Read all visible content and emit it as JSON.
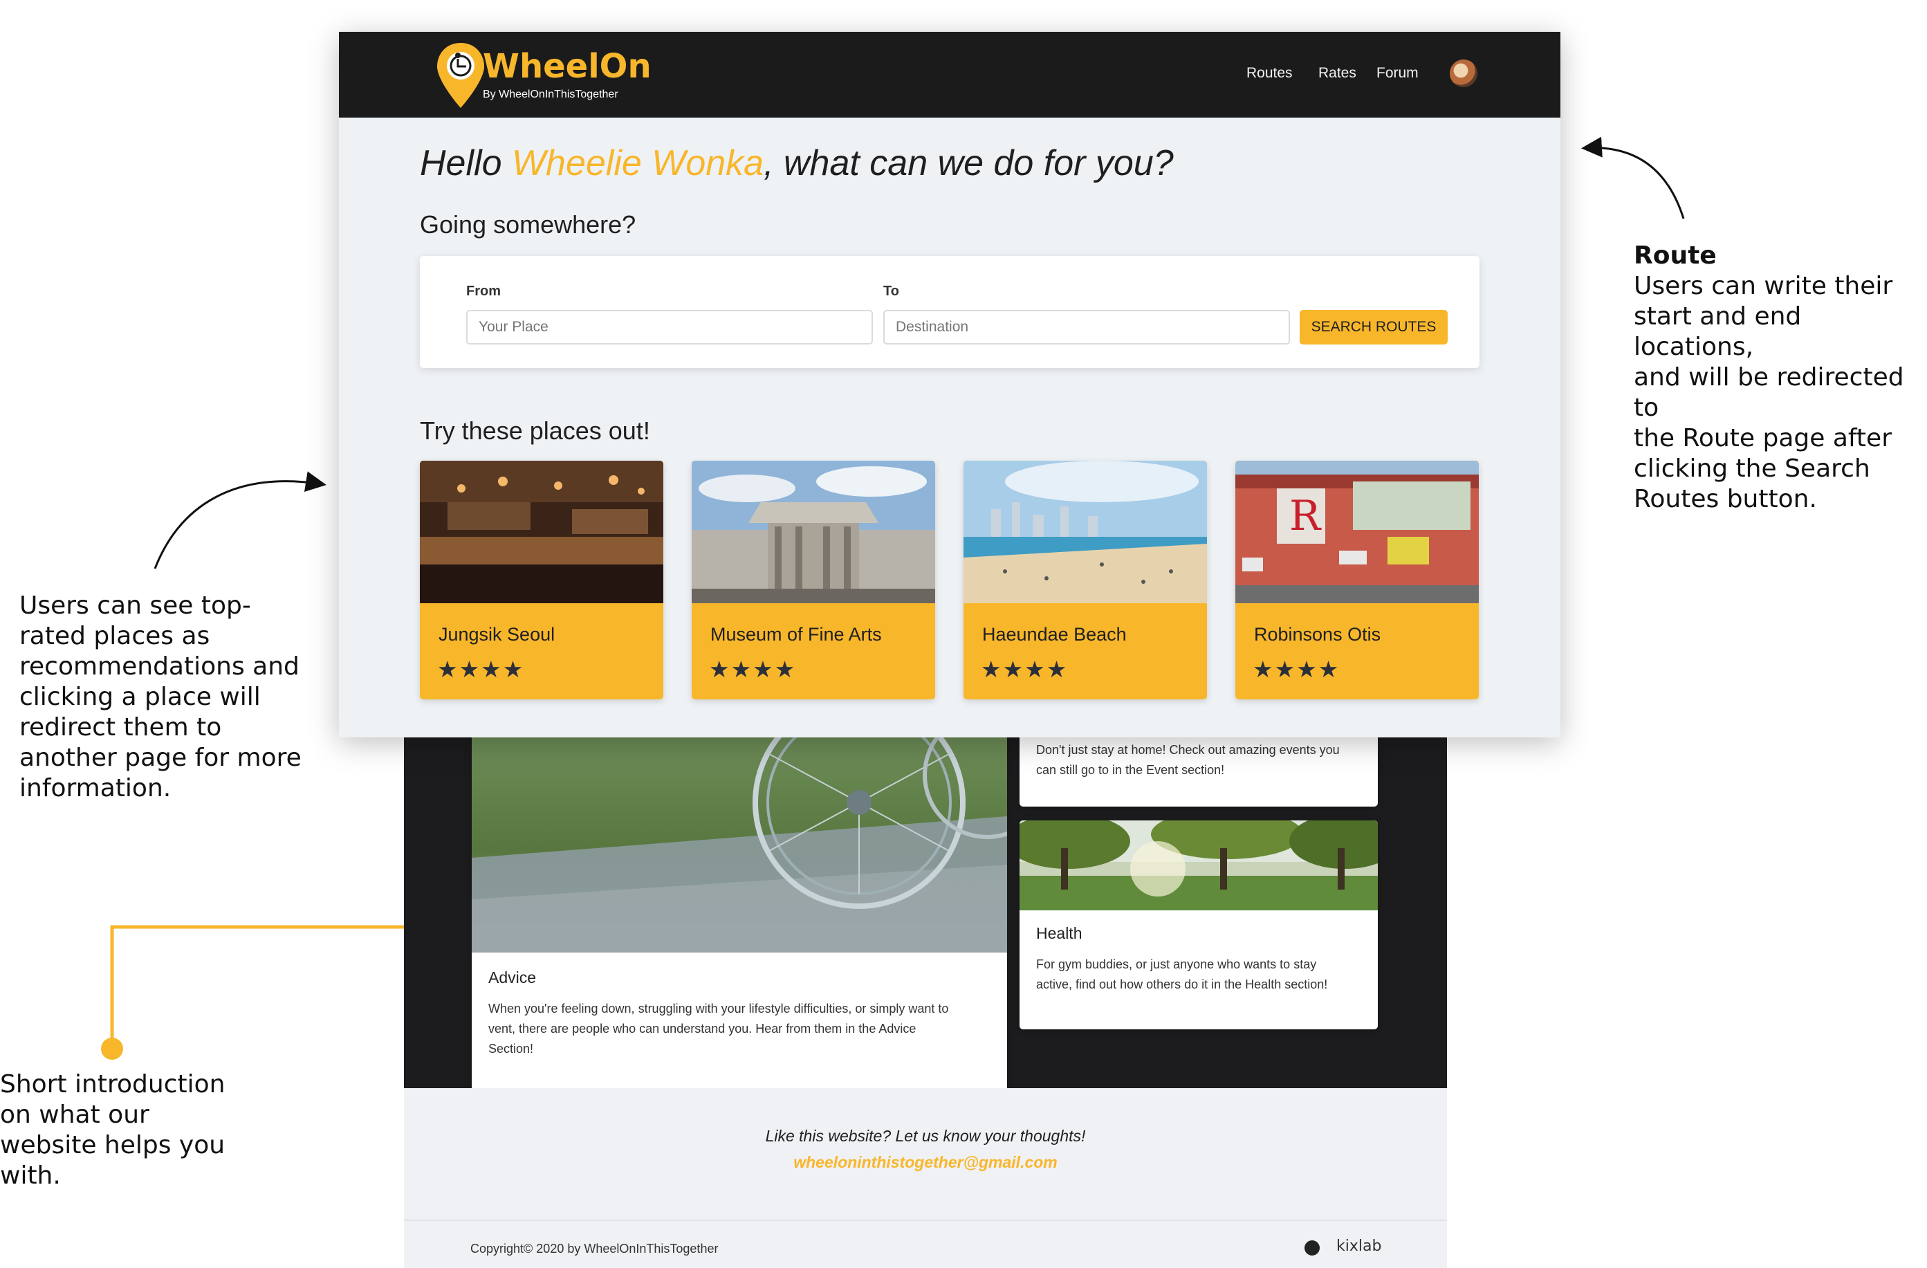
{
  "annotations": {
    "route": {
      "title": "Route",
      "lines": [
        "Users can write their",
        "start and end locations,",
        "and will be redirected to",
        "the Route page after",
        "clicking the Search",
        "Routes button."
      ]
    },
    "places": {
      "lines": [
        "Users can see top-",
        "rated places as",
        "recommendations and",
        "clicking a place will",
        "redirect them to",
        "another page for more",
        "information."
      ]
    },
    "intro": {
      "lines": [
        "Short introduction",
        "on what our",
        "website helps you",
        "with."
      ]
    }
  },
  "navbar": {
    "brand": "WheelOn",
    "tagline": "By WheelOnInThisTogether",
    "links": [
      "Routes",
      "Rates",
      "Forum"
    ]
  },
  "hero": {
    "greeting_prefix": "Hello ",
    "user_name": "Wheelie Wonka",
    "greeting_suffix": ", what can we do for you?",
    "subtitle": "Going somewhere?"
  },
  "search": {
    "from_label": "From",
    "from_placeholder": "Your Place",
    "to_label": "To",
    "to_placeholder": "Destination",
    "button_label": "SEARCH ROUTES"
  },
  "places": {
    "heading": "Try these places out!",
    "items": [
      {
        "name": "Jungsik Seoul",
        "stars": "★★★★",
        "rating": 4
      },
      {
        "name": "Museum of Fine Arts",
        "stars": "★★★★",
        "rating": 4
      },
      {
        "name": "Haeundae Beach",
        "stars": "★★★★",
        "rating": 4
      },
      {
        "name": "Robinsons Otis",
        "stars": "★★★★",
        "rating": 4
      }
    ]
  },
  "sections": {
    "events_text_1": "Don't just stay at home! Check out amazing events you",
    "events_text_2": "can still go to in the Event section!",
    "advice_title": "Advice",
    "advice_lines": [
      "When you're feeling down, struggling with your lifestyle difficulties, or simply want to",
      "vent, there are people who can understand you. Hear from them in the Advice",
      "Section!"
    ],
    "health_title": "Health",
    "health_lines": [
      "For gym buddies, or just anyone who wants to stay",
      "active, find out how others do it in the Health section!"
    ]
  },
  "footer": {
    "feedback_prompt": "Like this website? Let us know your thoughts!",
    "email": "wheeloninthistogether@gmail.com",
    "copyright": "Copyright© 2020 by WheelOnInThisTogether",
    "partner": "kixlab"
  },
  "colors": {
    "accent": "#f8b62b",
    "navbar": "#1b1b1b",
    "page_bg": "#eff2f5",
    "dark_section": "#1c1c1e"
  }
}
